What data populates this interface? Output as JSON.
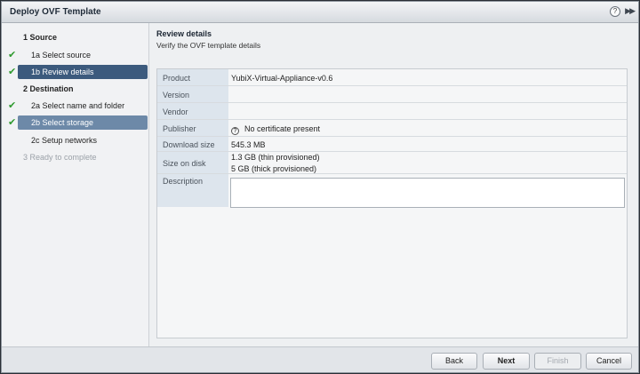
{
  "window": {
    "title": "Deploy OVF Template",
    "help_glyph": "?",
    "expand_glyph": "▶▶"
  },
  "sidebar": {
    "items": [
      {
        "label": "1  Source",
        "type": "section",
        "state": "normal",
        "checked": false
      },
      {
        "label": "1a  Select source",
        "type": "sub",
        "state": "normal",
        "checked": true
      },
      {
        "label": "1b  Review details",
        "type": "sub",
        "state": "active-dark",
        "checked": true
      },
      {
        "label": "2  Destination",
        "type": "section",
        "state": "normal",
        "checked": false
      },
      {
        "label": "2a  Select name and folder",
        "type": "sub",
        "state": "normal",
        "checked": true
      },
      {
        "label": "2b  Select storage",
        "type": "sub",
        "state": "active-light",
        "checked": true
      },
      {
        "label": "2c  Setup networks",
        "type": "sub",
        "state": "normal",
        "checked": false
      },
      {
        "label": "3  Ready to complete",
        "type": "section-disabled",
        "state": "disabled",
        "checked": false
      }
    ],
    "check_glyph": "✔"
  },
  "main": {
    "heading": "Review details",
    "subheading": "Verify the OVF template details",
    "fields": {
      "product": {
        "label": "Product",
        "value": "YubiX-Virtual-Appliance-v0.6"
      },
      "version": {
        "label": "Version",
        "value": ""
      },
      "vendor": {
        "label": "Vendor",
        "value": ""
      },
      "publisher": {
        "label": "Publisher",
        "value": "No certificate present",
        "icon": "question-icon",
        "icon_glyph": "?"
      },
      "download_size": {
        "label": "Download size",
        "value": "545.3 MB"
      },
      "size_on_disk": {
        "label": "Size on disk",
        "value_line1": "1.3 GB (thin provisioned)",
        "value_line2": "5 GB (thick provisioned)"
      },
      "description": {
        "label": "Description",
        "value": ""
      }
    }
  },
  "footer": {
    "back_label": "Back",
    "next_label": "Next",
    "finish_label": "Finish",
    "cancel_label": "Cancel"
  },
  "colors": {
    "active_dark": "#3c5a7d",
    "active_light": "#6d89a8",
    "check": "#2f9a2f"
  }
}
